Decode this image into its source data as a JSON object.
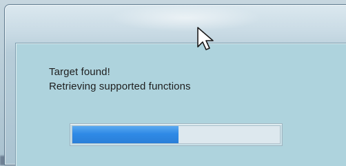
{
  "dialog": {
    "line1": "Target found!",
    "line2": "Retrieving supported functions"
  },
  "progress": {
    "fraction": 0.51
  },
  "colors": {
    "progress_fill": "#2f8ae6",
    "dialog_background": "#aed3dd"
  },
  "icons": {
    "cursor": "mouse-pointer-icon"
  }
}
